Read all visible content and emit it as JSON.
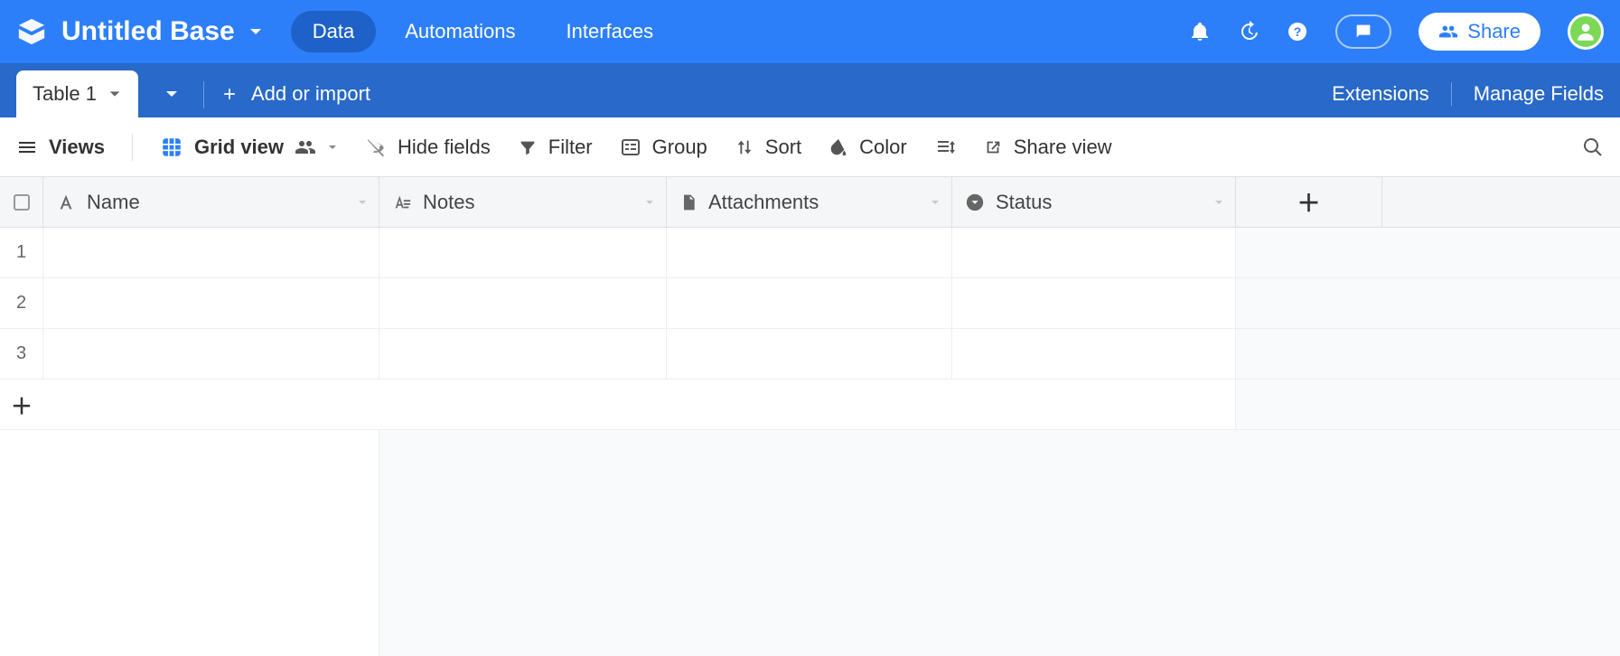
{
  "header": {
    "base_title": "Untitled Base",
    "tabs": {
      "data": "Data",
      "automations": "Automations",
      "interfaces": "Interfaces"
    },
    "share_label": "Share"
  },
  "tabbar": {
    "active_table": "Table 1",
    "add_import": "Add or import",
    "extensions": "Extensions",
    "manage_fields": "Manage Fields"
  },
  "toolbar": {
    "views": "Views",
    "grid_view": "Grid view",
    "hide_fields": "Hide fields",
    "filter": "Filter",
    "group": "Group",
    "sort": "Sort",
    "color": "Color",
    "share_view": "Share view"
  },
  "columns": {
    "name": "Name",
    "notes": "Notes",
    "attachments": "Attachments",
    "status": "Status"
  },
  "rows": [
    "1",
    "2",
    "3"
  ]
}
